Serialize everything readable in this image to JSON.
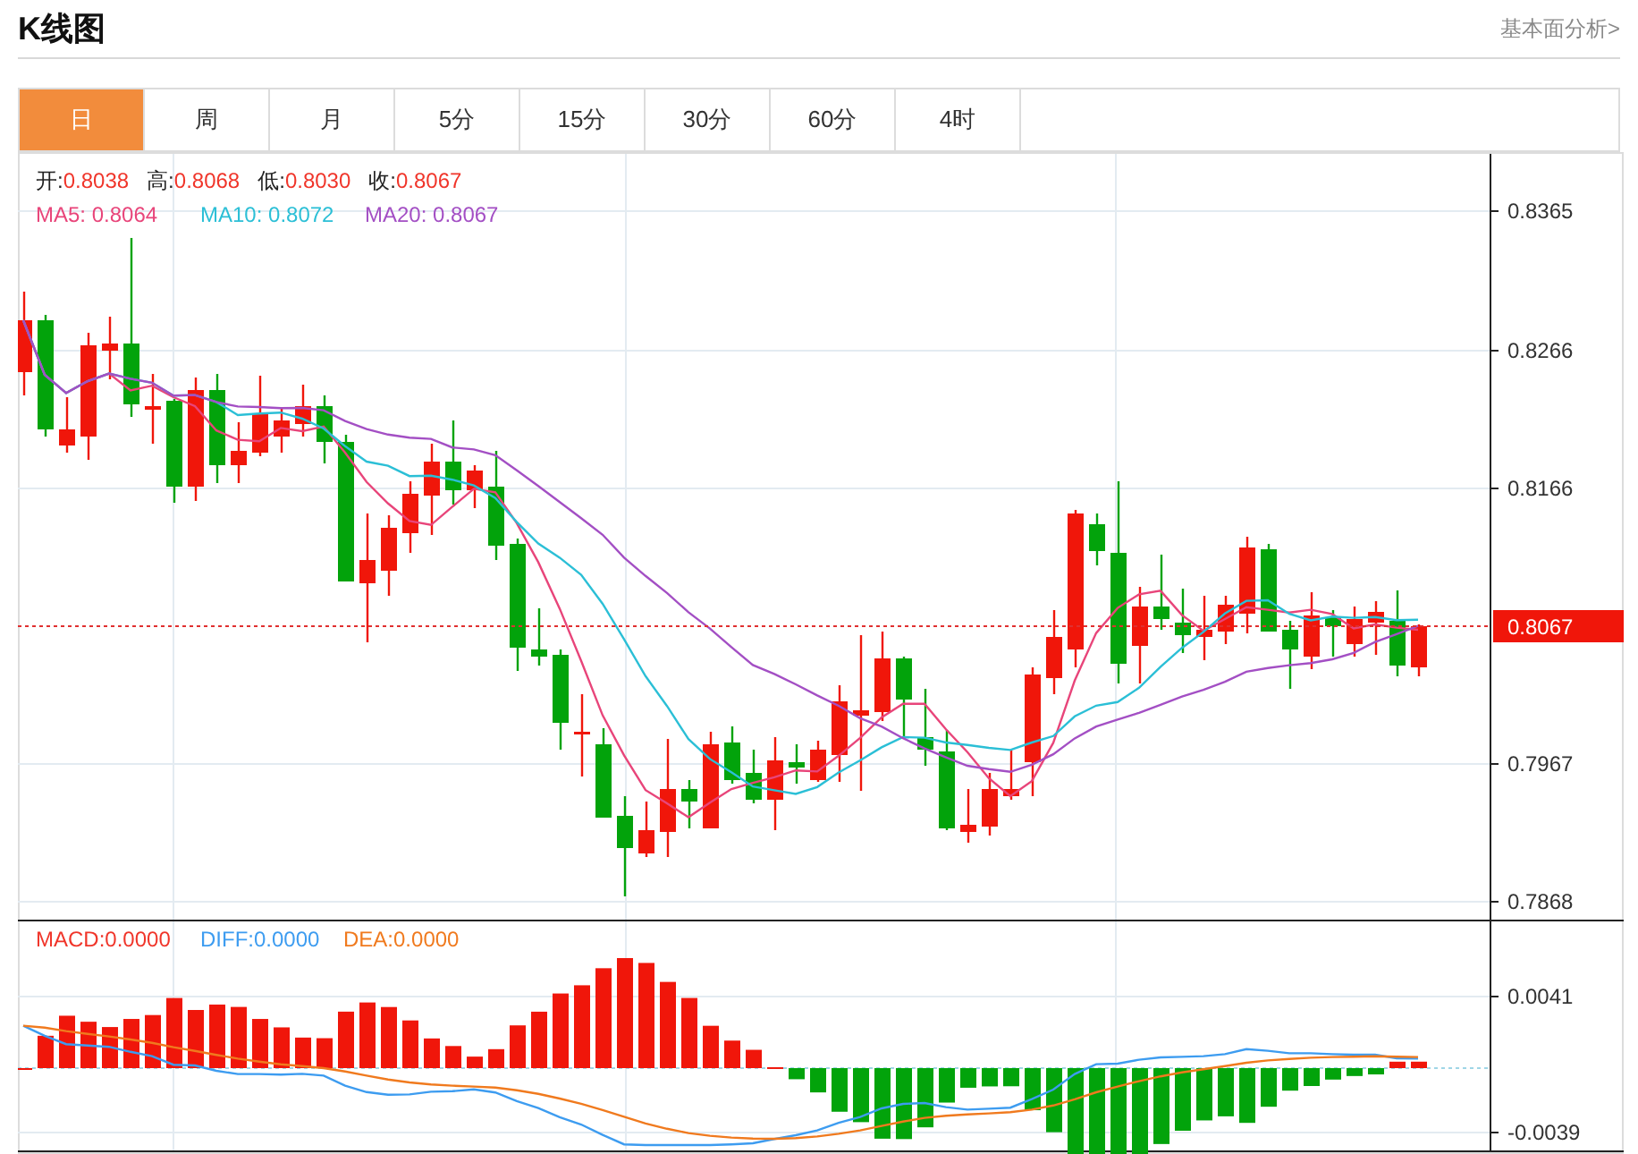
{
  "title": "K线图",
  "link": "基本面分析>",
  "tabs": [
    {
      "label": "日",
      "selected": true
    },
    {
      "label": "周",
      "selected": false
    },
    {
      "label": "月",
      "selected": false
    },
    {
      "label": "5分",
      "selected": false
    },
    {
      "label": "15分",
      "selected": false
    },
    {
      "label": "30分",
      "selected": false
    },
    {
      "label": "60分",
      "selected": false
    },
    {
      "label": "4时",
      "selected": false
    }
  ],
  "ohlc_legend": [
    {
      "label": "开:",
      "value": "0.8038"
    },
    {
      "label": "高:",
      "value": "0.8068"
    },
    {
      "label": "低:",
      "value": "0.8030"
    },
    {
      "label": "收:",
      "value": "0.8067"
    }
  ],
  "ma_legend": [
    {
      "label": "MA5: 0.8064",
      "color": "#e8457a"
    },
    {
      "label": "MA10: 0.8072",
      "color": "#2bbfd6"
    },
    {
      "label": "MA20: 0.8067",
      "color": "#a34fc4"
    }
  ],
  "price_axis": [
    "0.8365",
    "0.8266",
    "0.8166",
    "0.7967",
    "0.7868"
  ],
  "current_price": "0.8067",
  "macd_legend": [
    {
      "label": "MACD:0.0000",
      "color": "#f0352a"
    },
    {
      "label": "DIFF:0.0000",
      "color": "#3d9cf0"
    },
    {
      "label": "DEA:0.0000",
      "color": "#f07a1e"
    }
  ],
  "macd_axis": [
    "0.0041",
    "-0.0039"
  ]
}
